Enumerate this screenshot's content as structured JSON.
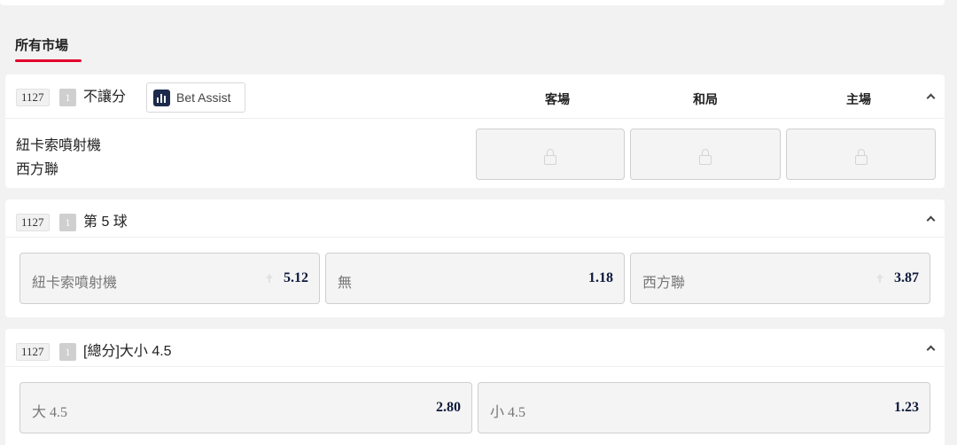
{
  "section": {
    "title": "所有市場"
  },
  "bet_assist": {
    "label": "Bet Assist"
  },
  "markets": [
    {
      "match_id": "1127",
      "period": "1",
      "name": "不讓分",
      "columns": [
        "客場",
        "和局",
        "主場"
      ],
      "teams": [
        "紐卡索噴射機",
        "西方聯"
      ],
      "locked": true
    },
    {
      "match_id": "1127",
      "period": "1",
      "name": "第 5 球",
      "selections": [
        {
          "label": "紐卡索噴射機",
          "odds": "5.12",
          "trend": "up"
        },
        {
          "label": "無",
          "odds": "1.18"
        },
        {
          "label": "西方聯",
          "odds": "3.87",
          "trend": "up"
        }
      ]
    },
    {
      "match_id": "1127",
      "period": "1",
      "name": "[總分]大小 4.5",
      "selections": [
        {
          "label": "大 4.5",
          "odds": "2.80"
        },
        {
          "label": "小 4.5",
          "odds": "1.23"
        }
      ]
    }
  ],
  "colors": {
    "accent": "#e4002b",
    "odds_text": "#0e1a3c",
    "bet_assist_icon": "#1d2a4b"
  }
}
